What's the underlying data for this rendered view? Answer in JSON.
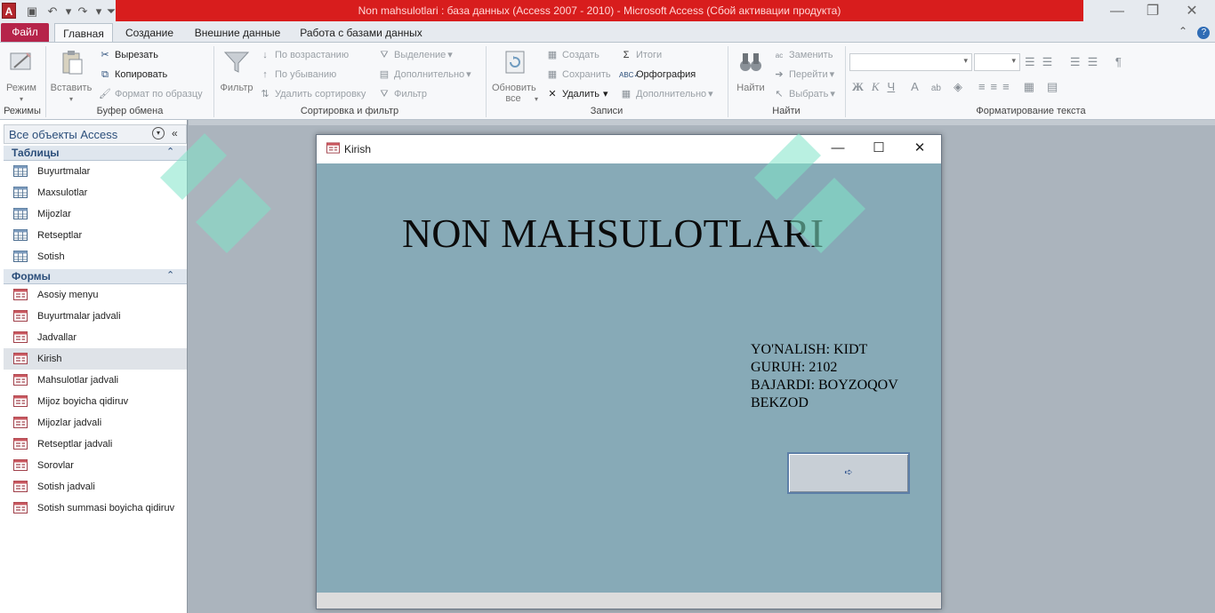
{
  "app": {
    "window_title": "Non mahsulotlari : база данных (Access 2007 - 2010)  -  Microsoft Access (Сбой активации продукта)",
    "app_icon_letter": "A"
  },
  "ribbon_tabs": [
    {
      "label": "Файл"
    },
    {
      "label": "Главная"
    },
    {
      "label": "Создание"
    },
    {
      "label": "Внешние данные"
    },
    {
      "label": "Работа с базами данных"
    }
  ],
  "ribbon": {
    "groups": {
      "modes": "Режимы",
      "clipboard": "Буфер обмена",
      "sort_filter": "Сортировка и фильтр",
      "records": "Записи",
      "find": "Найти",
      "text_format": "Форматирование текста"
    },
    "mode_button": "Режим",
    "paste_button": "Вставить",
    "cut": "Вырезать",
    "copy": "Копировать",
    "format_painter": "Формат по образцу",
    "filter_big": "Фильтр",
    "ascending": "По возрастанию",
    "descending": "По убыванию",
    "remove_sort": "Удалить сортировку",
    "selection": "Выделение",
    "advanced": "Дополнительно",
    "toggle_filter": "Фильтр",
    "refresh_all": "Обновить все",
    "new": "Создать",
    "save": "Сохранить",
    "delete": "Удалить",
    "totals": "Итоги",
    "spelling": "Орфография",
    "more": "Дополнительно",
    "find": "Найти",
    "replace": "Заменить",
    "goto": "Перейти",
    "select": "Выбрать"
  },
  "nav": {
    "title": "Все объекты Access",
    "sections": [
      {
        "label": "Таблицы",
        "items": [
          "Buyurtmalar",
          "Maxsulotlar",
          "Mijozlar",
          "Retseptlar",
          "Sotish"
        ]
      },
      {
        "label": "Формы",
        "items": [
          "Asosiy menyu",
          "Buyurtmalar jadvali",
          "Jadvallar",
          "Kirish",
          "Mahsulotlar jadvali",
          "Mijoz boyicha qidiruv",
          "Mijozlar jadvali",
          "Retseptlar jadvali",
          "Sorovlar",
          "Sotish jadvali",
          "Sotish summasi boyicha qidiruv"
        ]
      }
    ],
    "selected_item": "Kirish"
  },
  "form": {
    "window_title": "Kirish",
    "heading": "NON MAHSULOTLARI",
    "info_lines": [
      "YO'NALISH: KIDT",
      "GURUH: 2102",
      "BAJARDI: BOYZOQOV",
      "BEKZOD"
    ],
    "next_button_icon": "➪"
  },
  "colors": {
    "title_strip": "#d81d1d",
    "file_tab": "#b6244a",
    "form_body": "#87aab7",
    "nav_accent": "#2b4e7a"
  }
}
